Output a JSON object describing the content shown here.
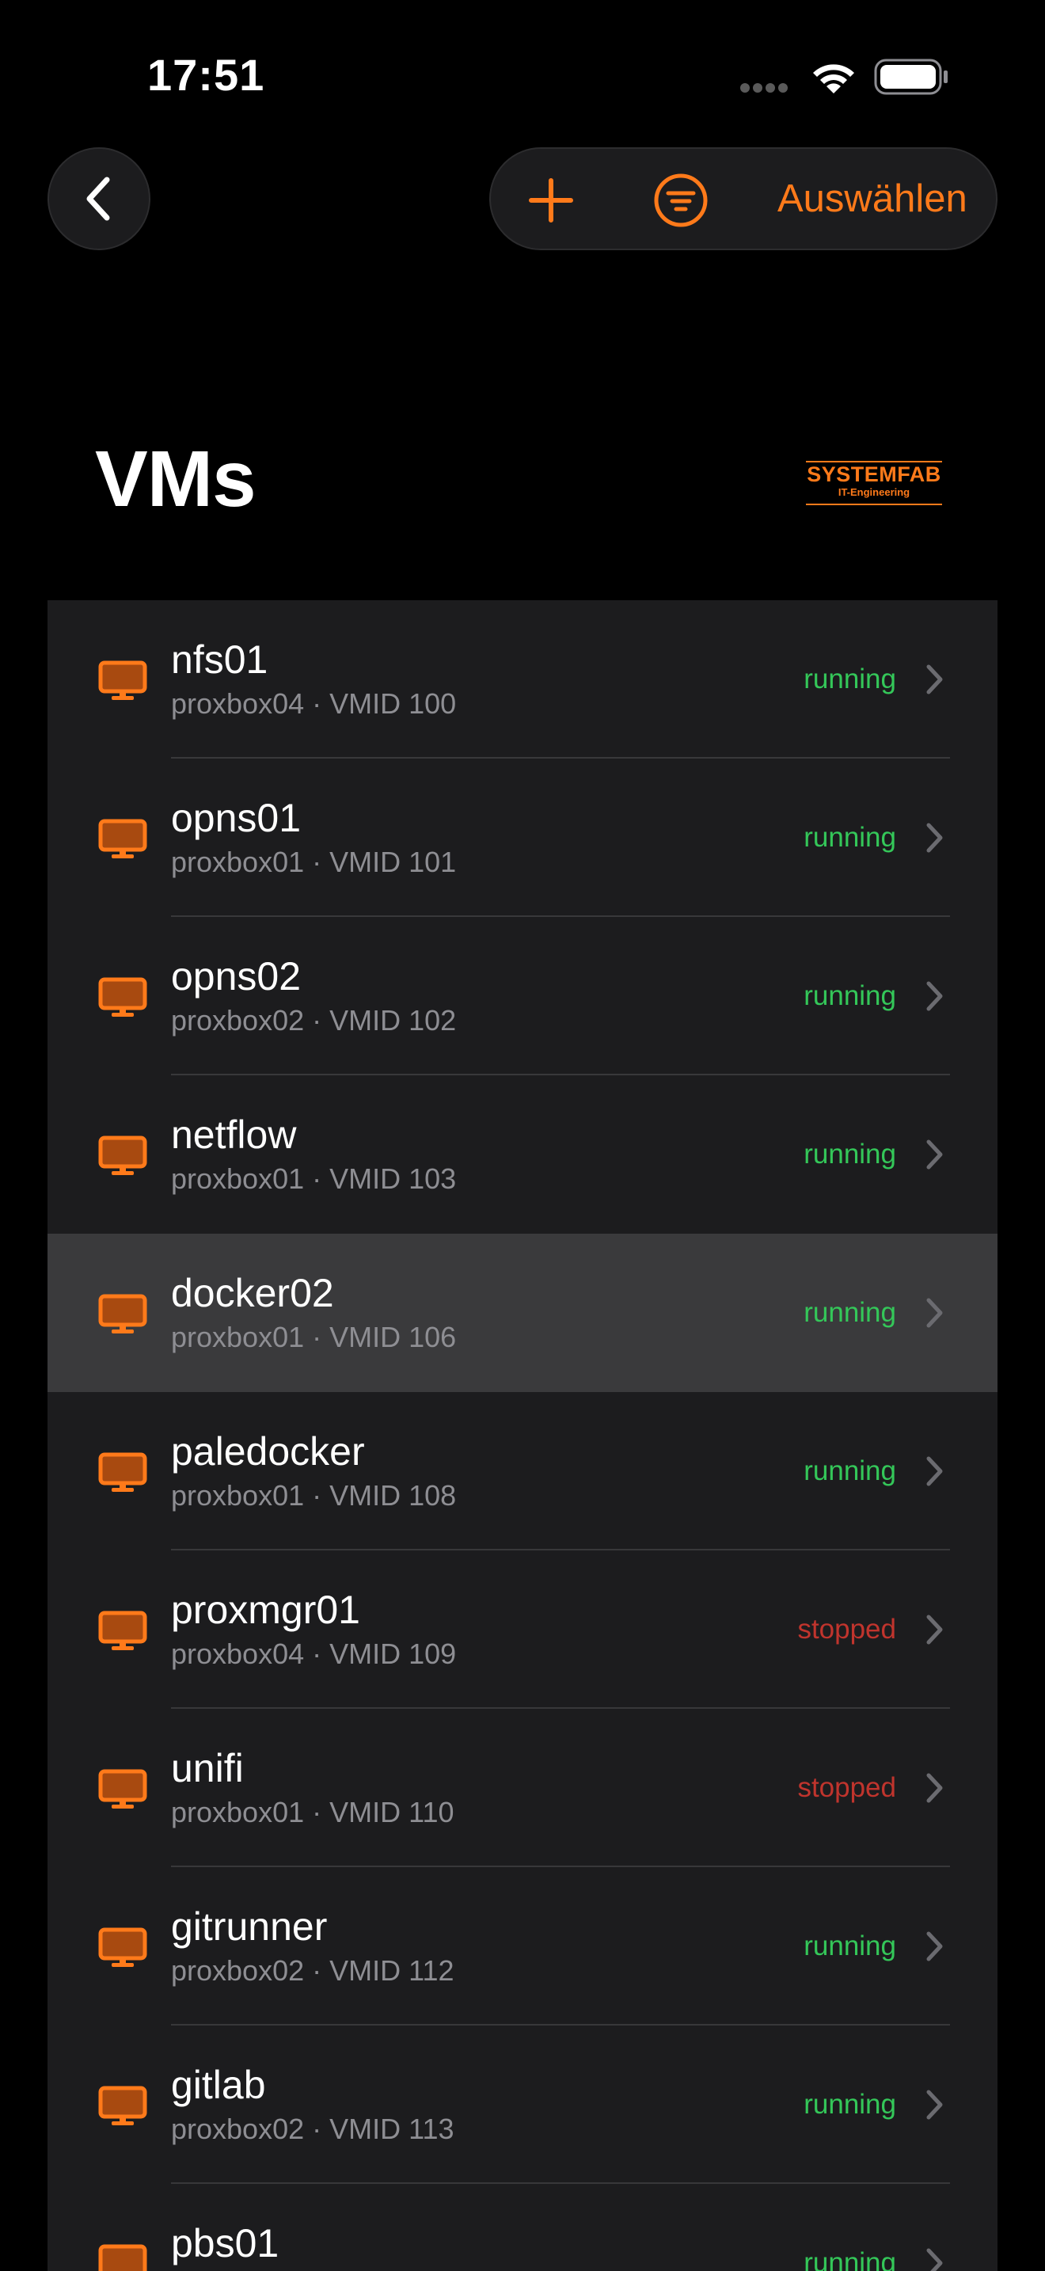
{
  "status_bar": {
    "time": "17:51"
  },
  "toolbar": {
    "select_label": "Auswählen"
  },
  "page": {
    "title": "VMs"
  },
  "logo": {
    "main": "SYSTEMFAB",
    "sub": "IT-Engineering"
  },
  "colors": {
    "accent": "#ff7a1a",
    "running": "#34c759",
    "stopped": "#c0342d"
  },
  "vms": [
    {
      "name": "nfs01",
      "subtitle": "proxbox04 · VMID 100",
      "status": "running"
    },
    {
      "name": "opns01",
      "subtitle": "proxbox01 · VMID 101",
      "status": "running"
    },
    {
      "name": "opns02",
      "subtitle": "proxbox02 · VMID 102",
      "status": "running"
    },
    {
      "name": "netflow",
      "subtitle": "proxbox01 · VMID 103",
      "status": "running"
    },
    {
      "name": "docker02",
      "subtitle": "proxbox01 · VMID 106",
      "status": "running",
      "highlighted": true
    },
    {
      "name": "paledocker",
      "subtitle": "proxbox01 · VMID 108",
      "status": "running"
    },
    {
      "name": "proxmgr01",
      "subtitle": "proxbox04 · VMID 109",
      "status": "stopped"
    },
    {
      "name": "unifi",
      "subtitle": "proxbox01 · VMID 110",
      "status": "stopped"
    },
    {
      "name": "gitrunner",
      "subtitle": "proxbox02 · VMID 112",
      "status": "running"
    },
    {
      "name": "gitlab",
      "subtitle": "proxbox02 · VMID 113",
      "status": "running"
    },
    {
      "name": "pbs01",
      "subtitle": "",
      "status": "running"
    }
  ]
}
